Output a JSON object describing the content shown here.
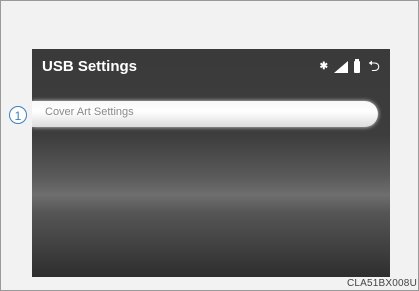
{
  "screen": {
    "title": "USB Settings",
    "status_icons": {
      "bluetooth": "bluetooth-icon",
      "signal": "signal-strength-icon",
      "battery": "battery-icon",
      "back": "back-icon"
    },
    "bluetooth_glyph": "✱",
    "back_glyph": "⮌",
    "items": [
      {
        "label": "Cover Art Settings"
      }
    ]
  },
  "callout": {
    "label": "1"
  },
  "caption": "CLA51BX008U"
}
